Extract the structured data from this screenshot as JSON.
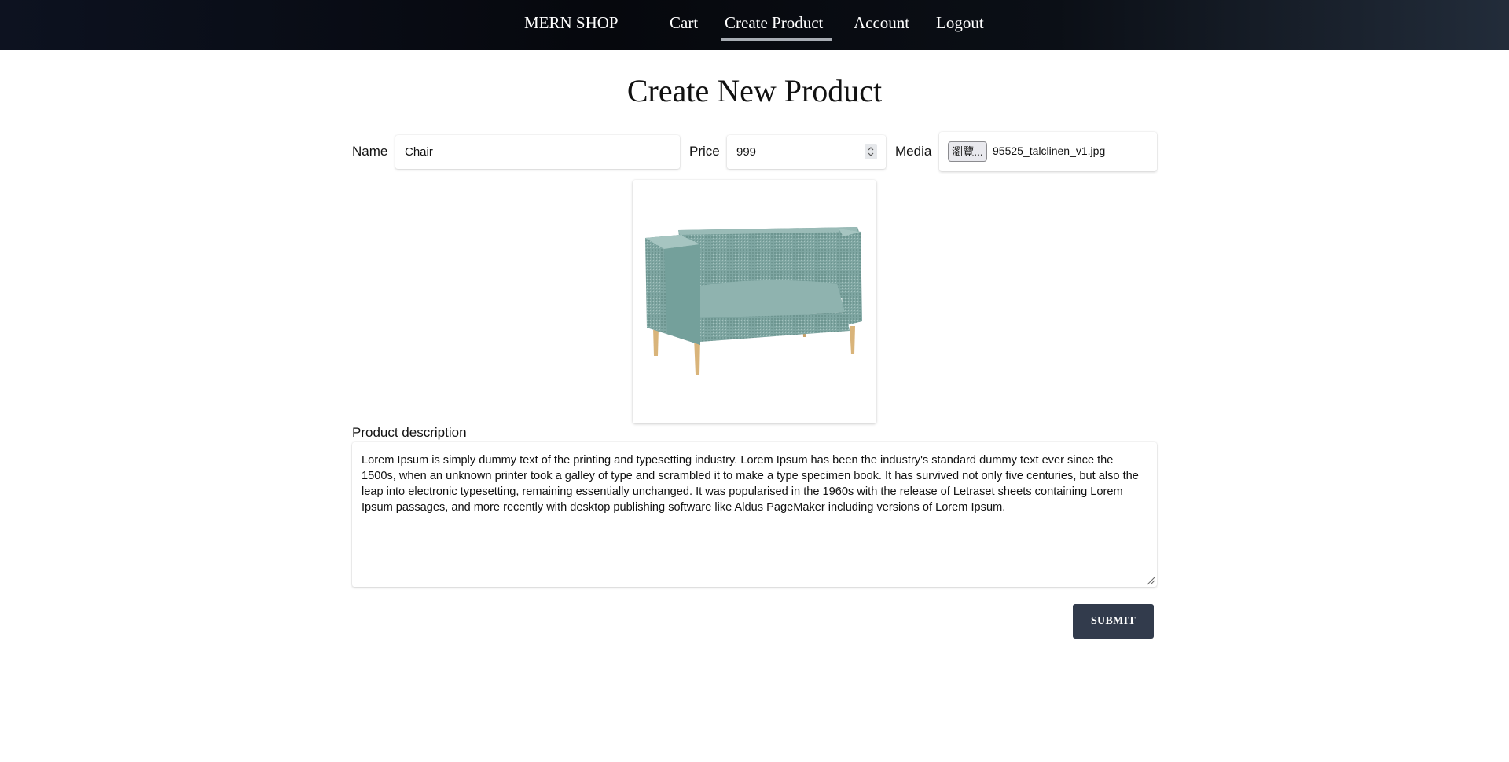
{
  "nav": {
    "brand": "MERN SHOP",
    "links": [
      "Cart",
      "Create Product",
      "Account",
      "Logout"
    ],
    "active": "Create Product"
  },
  "page": {
    "title": "Create New Product"
  },
  "form": {
    "name_label": "Name",
    "name_value": "Chair",
    "price_label": "Price",
    "price_value": "999",
    "media_label": "Media",
    "browse_button": "瀏覽...",
    "file_name": "95525_talclinen_v1.jpg",
    "description_label": "Product description",
    "description_value": "Lorem Ipsum is simply dummy text of the printing and typesetting industry. Lorem Ipsum has been the industry's standard dummy text ever since the 1500s, when an unknown printer took a galley of type and scrambled it to make a type specimen book. It has survived not only five centuries, but also the leap into electronic typesetting, remaining essentially unchanged. It was popularised in the 1960s with the release of Letraset sheets containing Lorem Ipsum passages, and more recently with desktop publishing software like Aldus PageMaker including versions of Lorem Ipsum.",
    "submit_label": "SUBMIT"
  },
  "colors": {
    "nav_bg": "#06080d",
    "active_underline": "#a7acb3",
    "submit_bg": "#323b4c",
    "sofa_fabric": "#7fa6a2",
    "sofa_legs": "#d9b47a"
  }
}
